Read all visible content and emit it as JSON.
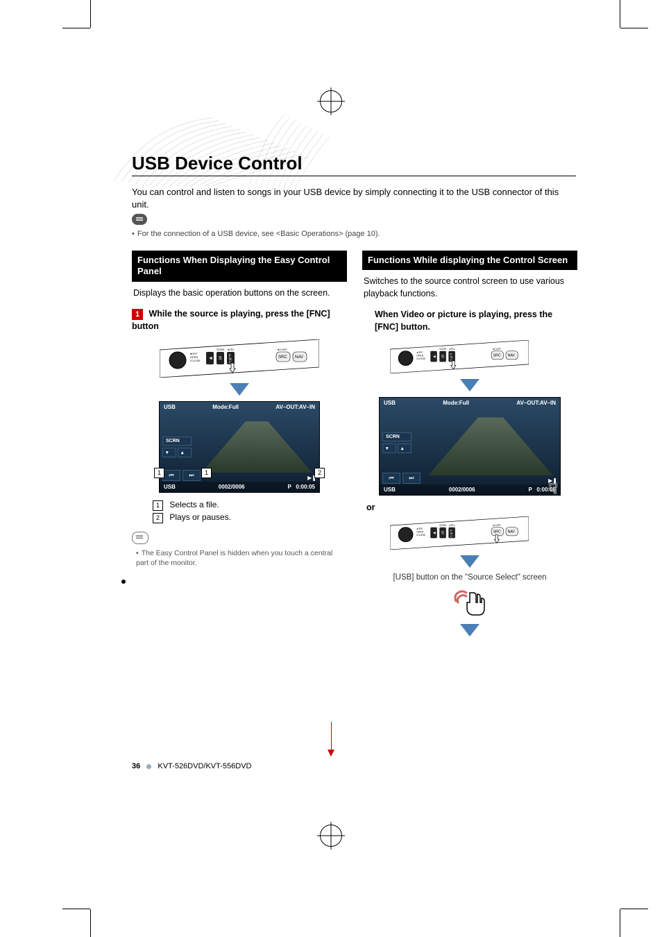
{
  "page_title": "USB Device Control",
  "intro": "You can control and listen to songs in your USB device by simply connecting it to the USB connector of this unit.",
  "connection_note": "For the connection of a USB device, see <Basic Operations> (page 10).",
  "left": {
    "header": "Functions When Displaying the Easy Control Panel",
    "desc": "Displays the basic operation buttons on the screen.",
    "step_num": "1",
    "step_text": "While the source is playing, press the [FNC] button",
    "screen": {
      "title_left": "USB",
      "title_mid": "Mode:Full",
      "title_right": "AV–OUT:AV–IN",
      "scrn_label": "SCRN",
      "bottom_left": "USB",
      "bottom_mid": "0002/0006",
      "bottom_right_p": "P",
      "bottom_right_time": "0:00:05",
      "callout1": "1",
      "callout2": "2"
    },
    "legend1_num": "1",
    "legend1_text": "Selects a file.",
    "legend2_num": "2",
    "legend2_text": "Plays or pauses.",
    "tiny_note": "The Easy Control Panel is hidden when you touch a central part of the monitor."
  },
  "right": {
    "header": "Functions While displaying the Control Screen",
    "desc": "Switches to the source control screen to use various playback functions.",
    "step_text": "When Video or picture is playing, press the [FNC] button.",
    "screen": {
      "title_left": "USB",
      "title_mid": "Mode:Full",
      "title_right": "AV–OUT:AV–IN",
      "scrn_label": "SCRN",
      "bottom_left": "USB",
      "bottom_mid": "0002/0006",
      "bottom_right_p": "P",
      "bottom_right_time": "0:00:05"
    },
    "or_text": "or",
    "caption": "[USB] button on the \"Source Select\" screen"
  },
  "device_buttons": {
    "off_open": "OFF\nOPEN\n/CLOSE",
    "scrn": "SCRN",
    "tel": "TEL",
    "voff": "V.OFF",
    "src": "SRC",
    "nav": "NAV",
    "left_knob_glyph": "◄",
    "s_glyph": "S",
    "fnc_glyph": "F\nN\nC"
  },
  "footer": {
    "page": "36",
    "model": "KVT-526DVD/KVT-556DVD"
  }
}
